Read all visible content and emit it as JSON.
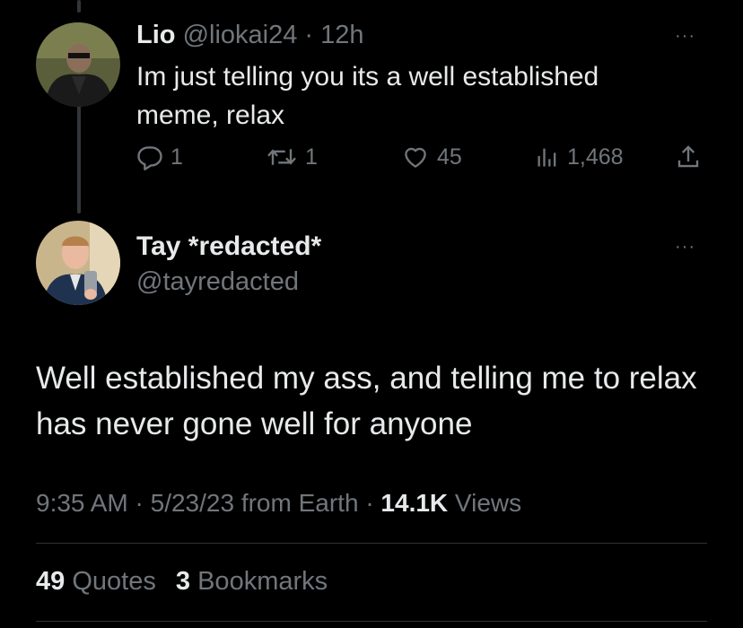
{
  "reply": {
    "author_name": "Lio",
    "author_handle": "@liokai24",
    "separator": "·",
    "time_ago": "12h",
    "text": "Im just telling you its a well established meme, relax",
    "actions": {
      "replies": "1",
      "reposts": "1",
      "likes": "45",
      "views": "1,468"
    },
    "more": "···"
  },
  "tweet": {
    "author_name": "Tay *redacted*",
    "author_handle": "@tayredacted",
    "text": "Well established my ass, and telling me to relax has never gone well for anyone",
    "time": "9:35 AM",
    "date": "5/23/23",
    "source": "from Earth",
    "views_count": "14.1K",
    "views_label": "Views",
    "more": "···",
    "quotes_count": "49",
    "quotes_label": "Quotes",
    "bookmarks_count": "3",
    "bookmarks_label": "Bookmarks"
  },
  "colors": {
    "background": "#000000",
    "text": "#e7e9ea",
    "muted": "#71767b",
    "divider": "#2f3336"
  },
  "icons": {
    "reply": "speech-bubble-icon",
    "repost": "repost-arrows-icon",
    "like": "heart-icon",
    "views": "bar-chart-icon",
    "share": "share-upload-icon",
    "more": "ellipsis-icon"
  }
}
